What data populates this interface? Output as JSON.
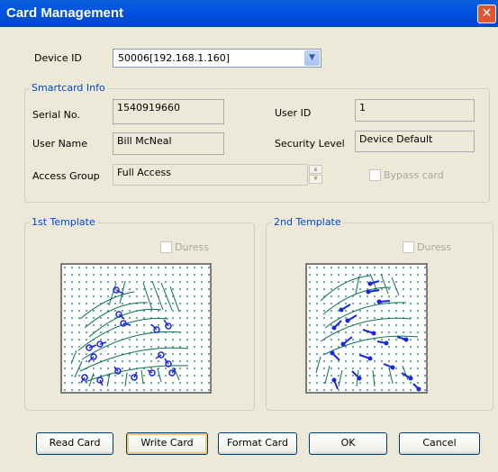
{
  "window": {
    "title": "Card Management",
    "close_symbol": "✕"
  },
  "device": {
    "label": "Device ID",
    "value": "50006[192.168.1.160]"
  },
  "smartcard": {
    "group_title": "Smartcard Info",
    "serial_label": "Serial No.",
    "serial_value": "1540919660",
    "user_id_label": "User ID",
    "user_id_value": "1",
    "user_name_label": "User Name",
    "user_name_value": "Bill McNeal",
    "security_label": "Security Level",
    "security_value": "Device Default",
    "access_label": "Access Group",
    "access_value": "Full Access",
    "bypass_label": "Bypass card"
  },
  "template1": {
    "group_title": "1st Template",
    "duress_label": "Duress"
  },
  "template2": {
    "group_title": "2nd Template",
    "duress_label": "Duress"
  },
  "buttons": {
    "read": "Read Card",
    "write": "Write Card",
    "format": "Format Card",
    "ok": "OK",
    "cancel": "Cancel"
  },
  "colors": {
    "title_bar": "#0054E3",
    "group_title": "#0046D5",
    "minutiae": "#1A24E6",
    "ridge": "#0A6E5A"
  }
}
